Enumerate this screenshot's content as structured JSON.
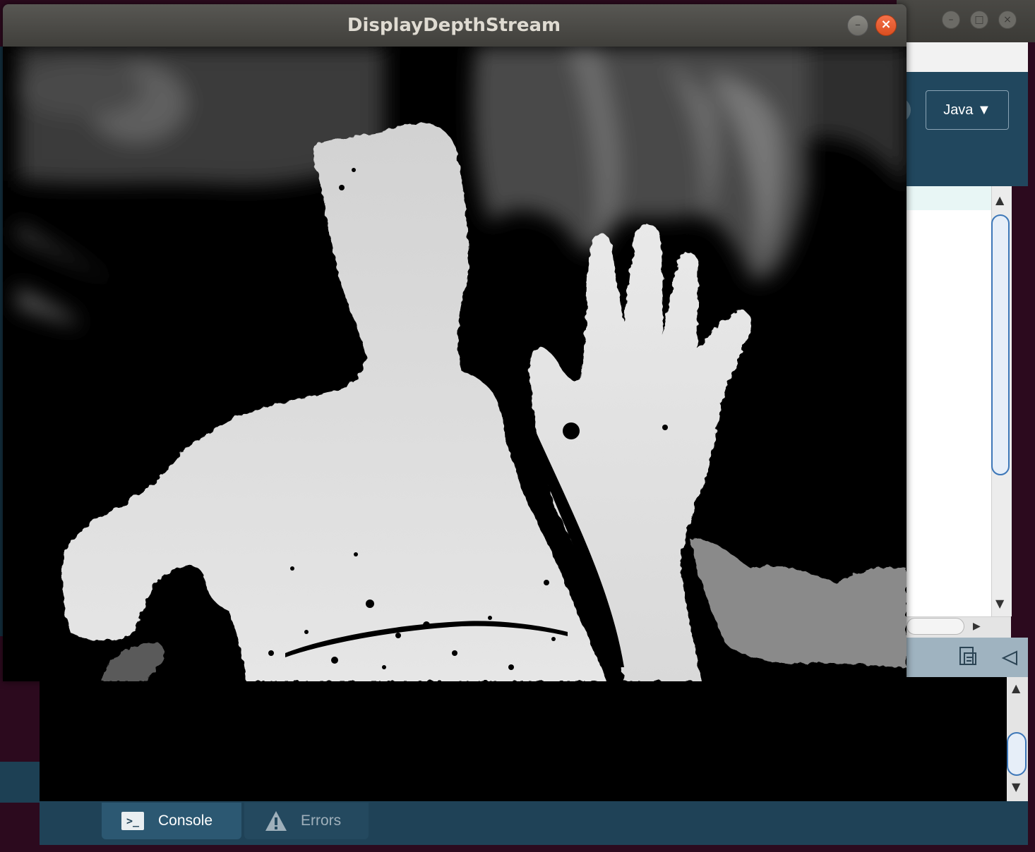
{
  "sketch_window": {
    "title": "DisplayDepthStream",
    "minimize_glyph": "–",
    "close_glyph": "×",
    "content": "depth-image",
    "colors": {
      "background": "#000000",
      "near": "#dcdcdc",
      "mid": "#8c8c8c",
      "far": "#3a3a3a"
    }
  },
  "ide": {
    "window_controls": {
      "minimize": "–",
      "maximize": "□",
      "close": "×"
    },
    "mode_button": {
      "label": "Java ▼"
    },
    "footer": {
      "tabs": [
        {
          "label": "Console",
          "icon": "console-icon",
          "selected": true
        },
        {
          "label": "Errors",
          "icon": "warning-icon",
          "selected": false
        }
      ]
    },
    "colors": {
      "toolbar": "#21475e",
      "footer": "#1f4257",
      "accent": "#3d77b8"
    }
  }
}
